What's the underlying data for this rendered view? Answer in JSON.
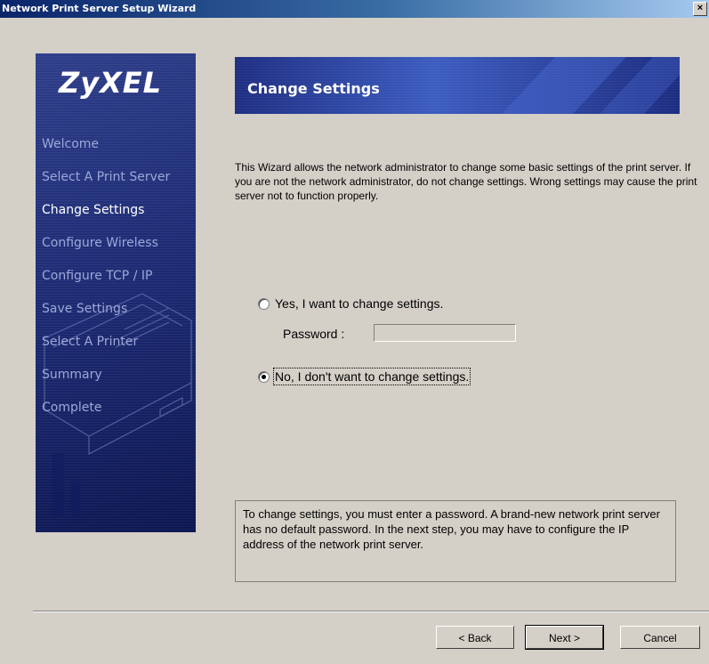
{
  "window": {
    "title": "Network Print Server Setup Wizard",
    "close_label": "×"
  },
  "sidebar": {
    "logo": "ZyXEL",
    "items": [
      {
        "label": "Welcome",
        "active": false
      },
      {
        "label": "Select A Print Server",
        "active": false
      },
      {
        "label": "Change Settings",
        "active": true
      },
      {
        "label": "Configure Wireless",
        "active": false
      },
      {
        "label": "Configure  TCP / IP",
        "active": false
      },
      {
        "label": "Save Settings",
        "active": false
      },
      {
        "label": "Select A Printer",
        "active": false
      },
      {
        "label": "Summary",
        "active": false
      },
      {
        "label": "Complete",
        "active": false
      }
    ]
  },
  "header": {
    "title": "Change Settings"
  },
  "description": "This Wizard allows the network administrator to change some basic settings of the print server. If you are not the network administrator, do not change settings. Wrong settings may cause the print server not to function properly.",
  "options": {
    "yes_label": "Yes, I want to change settings.",
    "no_label": "No, I don't want to change settings.",
    "selected": "no",
    "password_label": "Password :",
    "password_value": ""
  },
  "note": "To change settings, you must enter a password. A brand-new network print server has no default password. In the next step, you may have to configure the IP address of the network print server.",
  "buttons": {
    "back": "< Back",
    "next": "Next >",
    "cancel": "Cancel"
  },
  "colors": {
    "title_bar": "#0a246a",
    "sidebar": "#1c2a72",
    "header_band": "#2a3e9e",
    "dialog_bg": "#d4d0c8"
  }
}
